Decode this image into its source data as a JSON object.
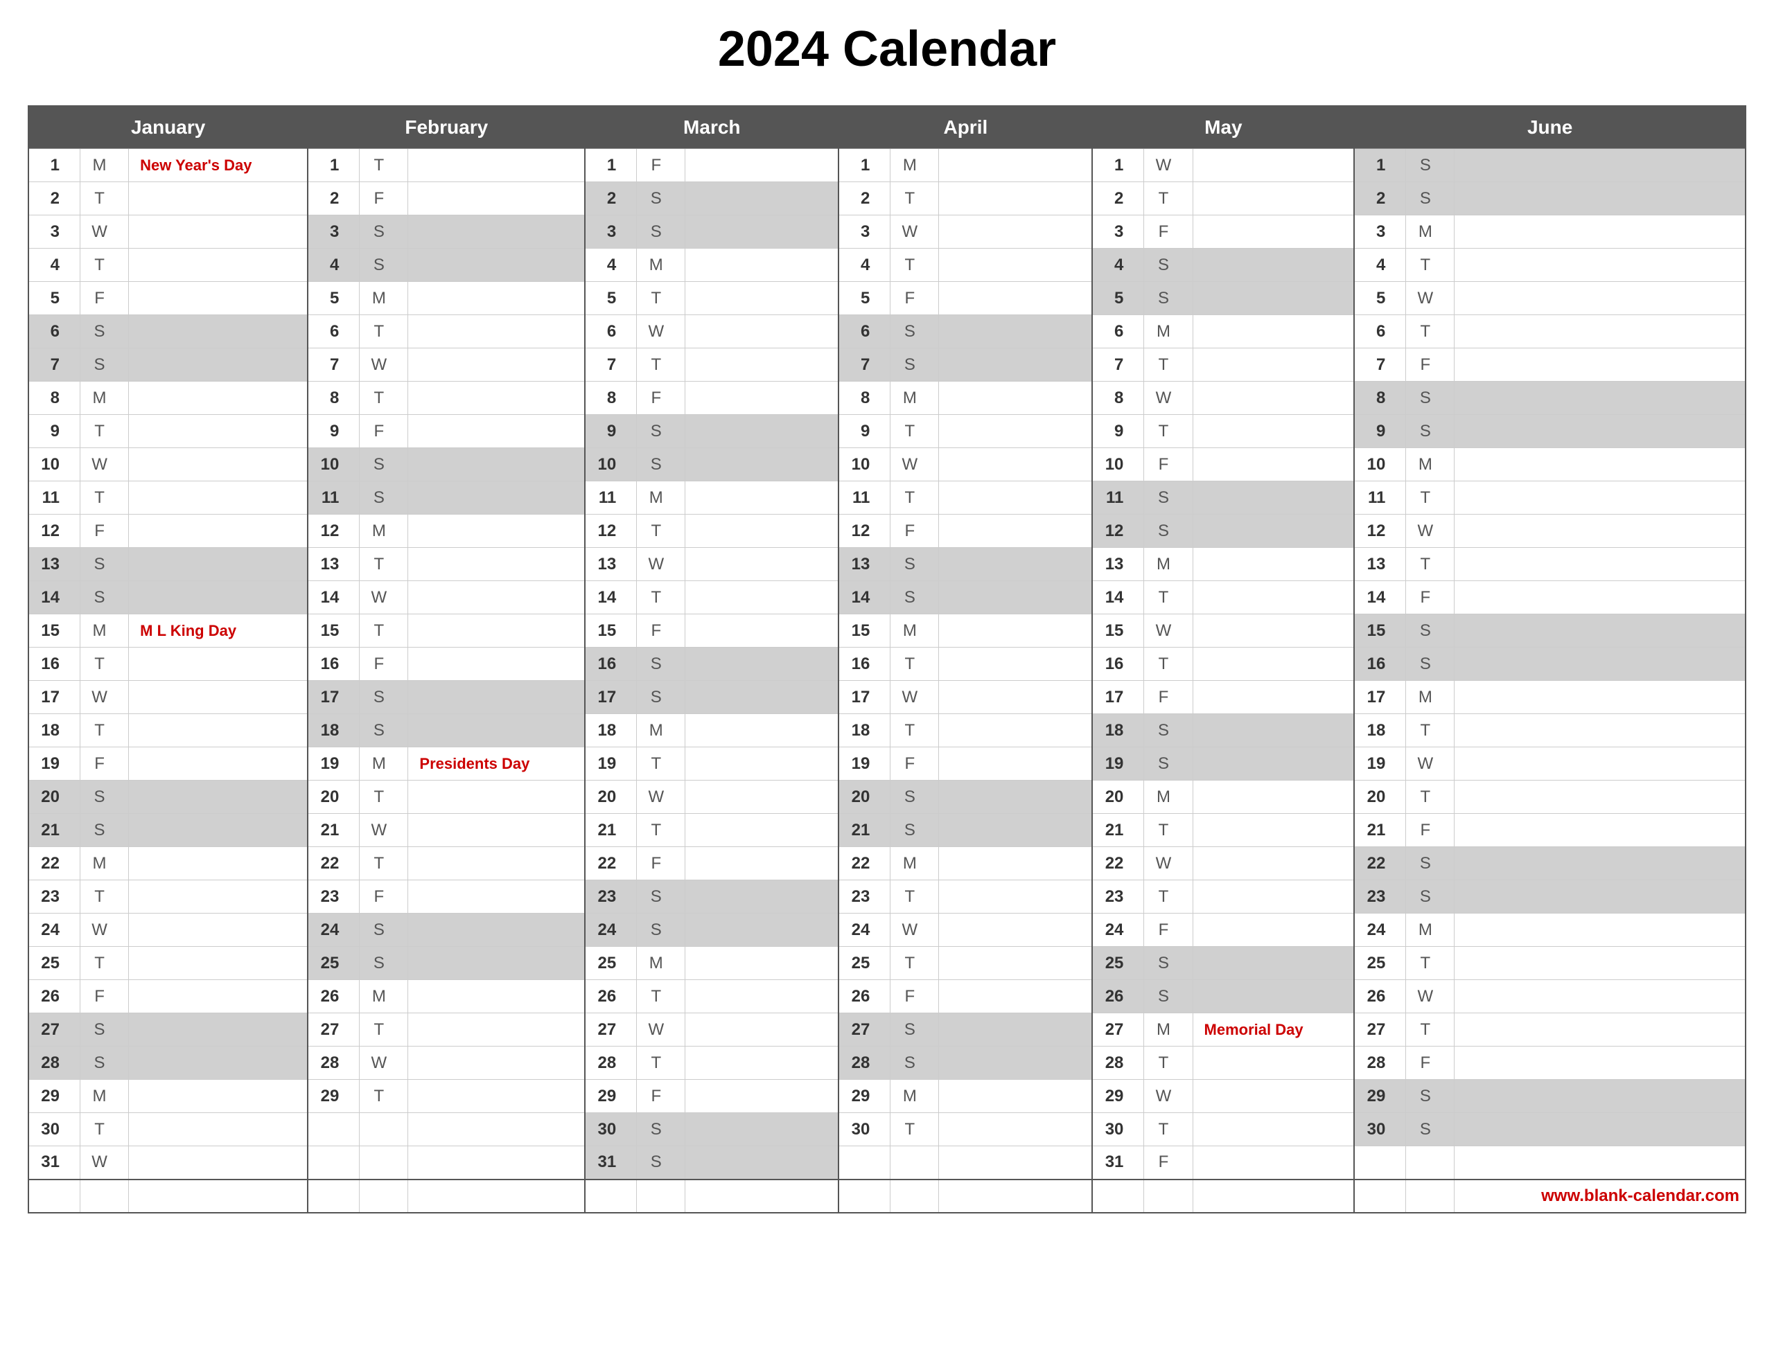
{
  "title": "2024 Calendar",
  "months": [
    "January",
    "February",
    "March",
    "April",
    "May",
    "June"
  ],
  "website": "www.blank-calendar.com",
  "days": {
    "january": [
      {
        "n": 1,
        "d": "M",
        "h": "New Year's Day"
      },
      {
        "n": 2,
        "d": "T",
        "h": ""
      },
      {
        "n": 3,
        "d": "W",
        "h": ""
      },
      {
        "n": 4,
        "d": "T",
        "h": ""
      },
      {
        "n": 5,
        "d": "F",
        "h": ""
      },
      {
        "n": 6,
        "d": "S",
        "h": "",
        "wk": true
      },
      {
        "n": 7,
        "d": "S",
        "h": "",
        "wk": true
      },
      {
        "n": 8,
        "d": "M",
        "h": ""
      },
      {
        "n": 9,
        "d": "T",
        "h": ""
      },
      {
        "n": 10,
        "d": "W",
        "h": ""
      },
      {
        "n": 11,
        "d": "T",
        "h": ""
      },
      {
        "n": 12,
        "d": "F",
        "h": ""
      },
      {
        "n": 13,
        "d": "S",
        "h": "",
        "wk": true
      },
      {
        "n": 14,
        "d": "S",
        "h": "",
        "wk": true
      },
      {
        "n": 15,
        "d": "M",
        "h": "M L King Day"
      },
      {
        "n": 16,
        "d": "T",
        "h": ""
      },
      {
        "n": 17,
        "d": "W",
        "h": ""
      },
      {
        "n": 18,
        "d": "T",
        "h": ""
      },
      {
        "n": 19,
        "d": "F",
        "h": ""
      },
      {
        "n": 20,
        "d": "S",
        "h": "",
        "wk": true
      },
      {
        "n": 21,
        "d": "S",
        "h": "",
        "wk": true
      },
      {
        "n": 22,
        "d": "M",
        "h": ""
      },
      {
        "n": 23,
        "d": "T",
        "h": ""
      },
      {
        "n": 24,
        "d": "W",
        "h": ""
      },
      {
        "n": 25,
        "d": "T",
        "h": ""
      },
      {
        "n": 26,
        "d": "F",
        "h": ""
      },
      {
        "n": 27,
        "d": "S",
        "h": "",
        "wk": true
      },
      {
        "n": 28,
        "d": "S",
        "h": "",
        "wk": true
      },
      {
        "n": 29,
        "d": "M",
        "h": ""
      },
      {
        "n": 30,
        "d": "T",
        "h": ""
      },
      {
        "n": 31,
        "d": "W",
        "h": ""
      }
    ],
    "february": [
      {
        "n": 1,
        "d": "T",
        "h": ""
      },
      {
        "n": 2,
        "d": "F",
        "h": ""
      },
      {
        "n": 3,
        "d": "S",
        "h": "",
        "wk": true
      },
      {
        "n": 4,
        "d": "S",
        "h": "",
        "wk": true
      },
      {
        "n": 5,
        "d": "M",
        "h": ""
      },
      {
        "n": 6,
        "d": "T",
        "h": ""
      },
      {
        "n": 7,
        "d": "W",
        "h": ""
      },
      {
        "n": 8,
        "d": "T",
        "h": ""
      },
      {
        "n": 9,
        "d": "F",
        "h": ""
      },
      {
        "n": 10,
        "d": "S",
        "h": "",
        "wk": true
      },
      {
        "n": 11,
        "d": "S",
        "h": "",
        "wk": true
      },
      {
        "n": 12,
        "d": "M",
        "h": ""
      },
      {
        "n": 13,
        "d": "T",
        "h": ""
      },
      {
        "n": 14,
        "d": "W",
        "h": ""
      },
      {
        "n": 15,
        "d": "T",
        "h": ""
      },
      {
        "n": 16,
        "d": "F",
        "h": ""
      },
      {
        "n": 17,
        "d": "S",
        "h": "",
        "wk": true
      },
      {
        "n": 18,
        "d": "S",
        "h": "",
        "wk": true
      },
      {
        "n": 19,
        "d": "M",
        "h": "Presidents Day"
      },
      {
        "n": 20,
        "d": "T",
        "h": ""
      },
      {
        "n": 21,
        "d": "W",
        "h": ""
      },
      {
        "n": 22,
        "d": "T",
        "h": ""
      },
      {
        "n": 23,
        "d": "F",
        "h": ""
      },
      {
        "n": 24,
        "d": "S",
        "h": "",
        "wk": true
      },
      {
        "n": 25,
        "d": "S",
        "h": "",
        "wk": true
      },
      {
        "n": 26,
        "d": "M",
        "h": ""
      },
      {
        "n": 27,
        "d": "T",
        "h": ""
      },
      {
        "n": 28,
        "d": "W",
        "h": ""
      },
      {
        "n": 29,
        "d": "T",
        "h": ""
      }
    ],
    "march": [
      {
        "n": 1,
        "d": "F",
        "h": ""
      },
      {
        "n": 2,
        "d": "S",
        "h": "",
        "wk": true
      },
      {
        "n": 3,
        "d": "S",
        "h": "",
        "wk": true
      },
      {
        "n": 4,
        "d": "M",
        "h": ""
      },
      {
        "n": 5,
        "d": "T",
        "h": ""
      },
      {
        "n": 6,
        "d": "W",
        "h": ""
      },
      {
        "n": 7,
        "d": "T",
        "h": ""
      },
      {
        "n": 8,
        "d": "F",
        "h": ""
      },
      {
        "n": 9,
        "d": "S",
        "h": "",
        "wk": true
      },
      {
        "n": 10,
        "d": "S",
        "h": "",
        "wk": true
      },
      {
        "n": 11,
        "d": "M",
        "h": ""
      },
      {
        "n": 12,
        "d": "T",
        "h": ""
      },
      {
        "n": 13,
        "d": "W",
        "h": ""
      },
      {
        "n": 14,
        "d": "T",
        "h": ""
      },
      {
        "n": 15,
        "d": "F",
        "h": ""
      },
      {
        "n": 16,
        "d": "S",
        "h": "",
        "wk": true
      },
      {
        "n": 17,
        "d": "S",
        "h": "",
        "wk": true
      },
      {
        "n": 18,
        "d": "M",
        "h": ""
      },
      {
        "n": 19,
        "d": "T",
        "h": ""
      },
      {
        "n": 20,
        "d": "W",
        "h": ""
      },
      {
        "n": 21,
        "d": "T",
        "h": ""
      },
      {
        "n": 22,
        "d": "F",
        "h": ""
      },
      {
        "n": 23,
        "d": "S",
        "h": "",
        "wk": true
      },
      {
        "n": 24,
        "d": "S",
        "h": "",
        "wk": true
      },
      {
        "n": 25,
        "d": "M",
        "h": ""
      },
      {
        "n": 26,
        "d": "T",
        "h": ""
      },
      {
        "n": 27,
        "d": "W",
        "h": ""
      },
      {
        "n": 28,
        "d": "T",
        "h": ""
      },
      {
        "n": 29,
        "d": "F",
        "h": ""
      },
      {
        "n": 30,
        "d": "S",
        "h": "",
        "wk": true
      },
      {
        "n": 31,
        "d": "S",
        "h": "",
        "wk": true
      }
    ],
    "april": [
      {
        "n": 1,
        "d": "M",
        "h": ""
      },
      {
        "n": 2,
        "d": "T",
        "h": ""
      },
      {
        "n": 3,
        "d": "W",
        "h": ""
      },
      {
        "n": 4,
        "d": "T",
        "h": ""
      },
      {
        "n": 5,
        "d": "F",
        "h": ""
      },
      {
        "n": 6,
        "d": "S",
        "h": "",
        "wk": true
      },
      {
        "n": 7,
        "d": "S",
        "h": "",
        "wk": true
      },
      {
        "n": 8,
        "d": "M",
        "h": ""
      },
      {
        "n": 9,
        "d": "T",
        "h": ""
      },
      {
        "n": 10,
        "d": "W",
        "h": ""
      },
      {
        "n": 11,
        "d": "T",
        "h": ""
      },
      {
        "n": 12,
        "d": "F",
        "h": ""
      },
      {
        "n": 13,
        "d": "S",
        "h": "",
        "wk": true
      },
      {
        "n": 14,
        "d": "S",
        "h": "",
        "wk": true
      },
      {
        "n": 15,
        "d": "M",
        "h": ""
      },
      {
        "n": 16,
        "d": "T",
        "h": ""
      },
      {
        "n": 17,
        "d": "W",
        "h": ""
      },
      {
        "n": 18,
        "d": "T",
        "h": ""
      },
      {
        "n": 19,
        "d": "F",
        "h": ""
      },
      {
        "n": 20,
        "d": "S",
        "h": "",
        "wk": true
      },
      {
        "n": 21,
        "d": "S",
        "h": "",
        "wk": true
      },
      {
        "n": 22,
        "d": "M",
        "h": ""
      },
      {
        "n": 23,
        "d": "T",
        "h": ""
      },
      {
        "n": 24,
        "d": "W",
        "h": ""
      },
      {
        "n": 25,
        "d": "T",
        "h": ""
      },
      {
        "n": 26,
        "d": "F",
        "h": ""
      },
      {
        "n": 27,
        "d": "S",
        "h": "",
        "wk": true
      },
      {
        "n": 28,
        "d": "S",
        "h": "",
        "wk": true
      },
      {
        "n": 29,
        "d": "M",
        "h": ""
      },
      {
        "n": 30,
        "d": "T",
        "h": ""
      }
    ],
    "may": [
      {
        "n": 1,
        "d": "W",
        "h": ""
      },
      {
        "n": 2,
        "d": "T",
        "h": ""
      },
      {
        "n": 3,
        "d": "F",
        "h": ""
      },
      {
        "n": 4,
        "d": "S",
        "h": "",
        "wk": true
      },
      {
        "n": 5,
        "d": "S",
        "h": "",
        "wk": true
      },
      {
        "n": 6,
        "d": "M",
        "h": ""
      },
      {
        "n": 7,
        "d": "T",
        "h": ""
      },
      {
        "n": 8,
        "d": "W",
        "h": ""
      },
      {
        "n": 9,
        "d": "T",
        "h": ""
      },
      {
        "n": 10,
        "d": "F",
        "h": ""
      },
      {
        "n": 11,
        "d": "S",
        "h": "",
        "wk": true
      },
      {
        "n": 12,
        "d": "S",
        "h": "",
        "wk": true
      },
      {
        "n": 13,
        "d": "M",
        "h": ""
      },
      {
        "n": 14,
        "d": "T",
        "h": ""
      },
      {
        "n": 15,
        "d": "W",
        "h": ""
      },
      {
        "n": 16,
        "d": "T",
        "h": ""
      },
      {
        "n": 17,
        "d": "F",
        "h": ""
      },
      {
        "n": 18,
        "d": "S",
        "h": "",
        "wk": true
      },
      {
        "n": 19,
        "d": "S",
        "h": "",
        "wk": true
      },
      {
        "n": 20,
        "d": "M",
        "h": ""
      },
      {
        "n": 21,
        "d": "T",
        "h": ""
      },
      {
        "n": 22,
        "d": "W",
        "h": ""
      },
      {
        "n": 23,
        "d": "T",
        "h": ""
      },
      {
        "n": 24,
        "d": "F",
        "h": ""
      },
      {
        "n": 25,
        "d": "S",
        "h": "",
        "wk": true
      },
      {
        "n": 26,
        "d": "S",
        "h": "",
        "wk": true
      },
      {
        "n": 27,
        "d": "M",
        "h": "Memorial Day"
      },
      {
        "n": 28,
        "d": "T",
        "h": ""
      },
      {
        "n": 29,
        "d": "W",
        "h": ""
      },
      {
        "n": 30,
        "d": "T",
        "h": ""
      },
      {
        "n": 31,
        "d": "F",
        "h": ""
      }
    ],
    "june": [
      {
        "n": 1,
        "d": "S",
        "h": "",
        "wk": true
      },
      {
        "n": 2,
        "d": "S",
        "h": "",
        "wk": true
      },
      {
        "n": 3,
        "d": "M",
        "h": ""
      },
      {
        "n": 4,
        "d": "T",
        "h": ""
      },
      {
        "n": 5,
        "d": "W",
        "h": ""
      },
      {
        "n": 6,
        "d": "T",
        "h": ""
      },
      {
        "n": 7,
        "d": "F",
        "h": ""
      },
      {
        "n": 8,
        "d": "S",
        "h": "",
        "wk": true
      },
      {
        "n": 9,
        "d": "S",
        "h": "",
        "wk": true
      },
      {
        "n": 10,
        "d": "M",
        "h": ""
      },
      {
        "n": 11,
        "d": "T",
        "h": ""
      },
      {
        "n": 12,
        "d": "W",
        "h": ""
      },
      {
        "n": 13,
        "d": "T",
        "h": ""
      },
      {
        "n": 14,
        "d": "F",
        "h": ""
      },
      {
        "n": 15,
        "d": "S",
        "h": "",
        "wk": true
      },
      {
        "n": 16,
        "d": "S",
        "h": "",
        "wk": true
      },
      {
        "n": 17,
        "d": "M",
        "h": ""
      },
      {
        "n": 18,
        "d": "T",
        "h": ""
      },
      {
        "n": 19,
        "d": "W",
        "h": ""
      },
      {
        "n": 20,
        "d": "T",
        "h": ""
      },
      {
        "n": 21,
        "d": "F",
        "h": ""
      },
      {
        "n": 22,
        "d": "S",
        "h": "",
        "wk": true
      },
      {
        "n": 23,
        "d": "S",
        "h": "",
        "wk": true
      },
      {
        "n": 24,
        "d": "M",
        "h": ""
      },
      {
        "n": 25,
        "d": "T",
        "h": ""
      },
      {
        "n": 26,
        "d": "W",
        "h": ""
      },
      {
        "n": 27,
        "d": "T",
        "h": ""
      },
      {
        "n": 28,
        "d": "F",
        "h": ""
      },
      {
        "n": 29,
        "d": "S",
        "h": "",
        "wk": true
      },
      {
        "n": 30,
        "d": "S",
        "h": "",
        "wk": true
      }
    ]
  }
}
